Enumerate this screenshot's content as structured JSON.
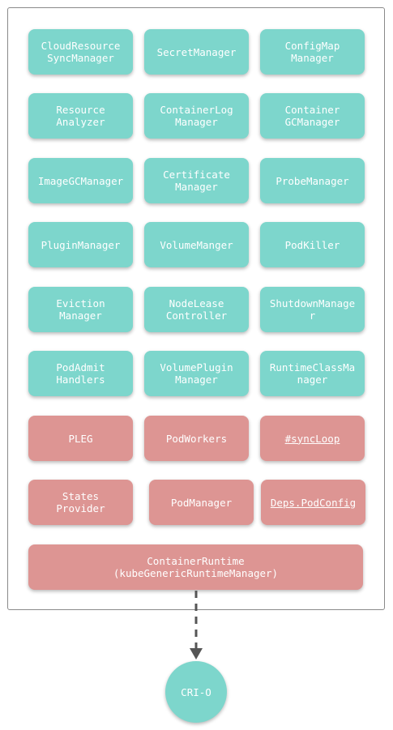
{
  "components": {
    "cloud_resource_sync_manager": "CloudResource\nSyncManager",
    "secret_manager": "SecretManager",
    "configmap_manager": "ConfigMap\nManager",
    "resource_analyzer": "Resource\nAnalyzer",
    "container_log_manager": "ContainerLog\nManager",
    "container_gc_manager": "Container\nGCManager",
    "image_gc_manager": "ImageGCManager",
    "certificate_manager": "Certificate\nManager",
    "probe_manager": "ProbeManager",
    "plugin_manager": "PluginManager",
    "volume_manger": "VolumeManger",
    "pod_killer": "PodKiller",
    "eviction_manager": "Eviction\nManager",
    "node_lease_controller": "NodeLease\nController",
    "shutdown_manager": "ShutdownManage\nr",
    "pod_admit_handlers": "PodAdmit\nHandlers",
    "volume_plugin_manager": "VolumePlugin\nManager",
    "runtime_class_manager": "RuntimeClassMa\nnager",
    "pleg": "PLEG",
    "pod_workers": "PodWorkers",
    "sync_loop": "#syncLoop",
    "states_provider": "States\nProvider",
    "pod_manager": "PodManager",
    "deps_pod_config": "Deps.PodConfig",
    "container_runtime": "ContainerRuntime\n(kubeGenericRuntimeManager)"
  },
  "external": {
    "cri_o": "CRI-O"
  },
  "colors": {
    "teal": "#7dd6cc",
    "red": "#dd9593",
    "frame": "#8a8a8a",
    "arrow": "#555555"
  }
}
